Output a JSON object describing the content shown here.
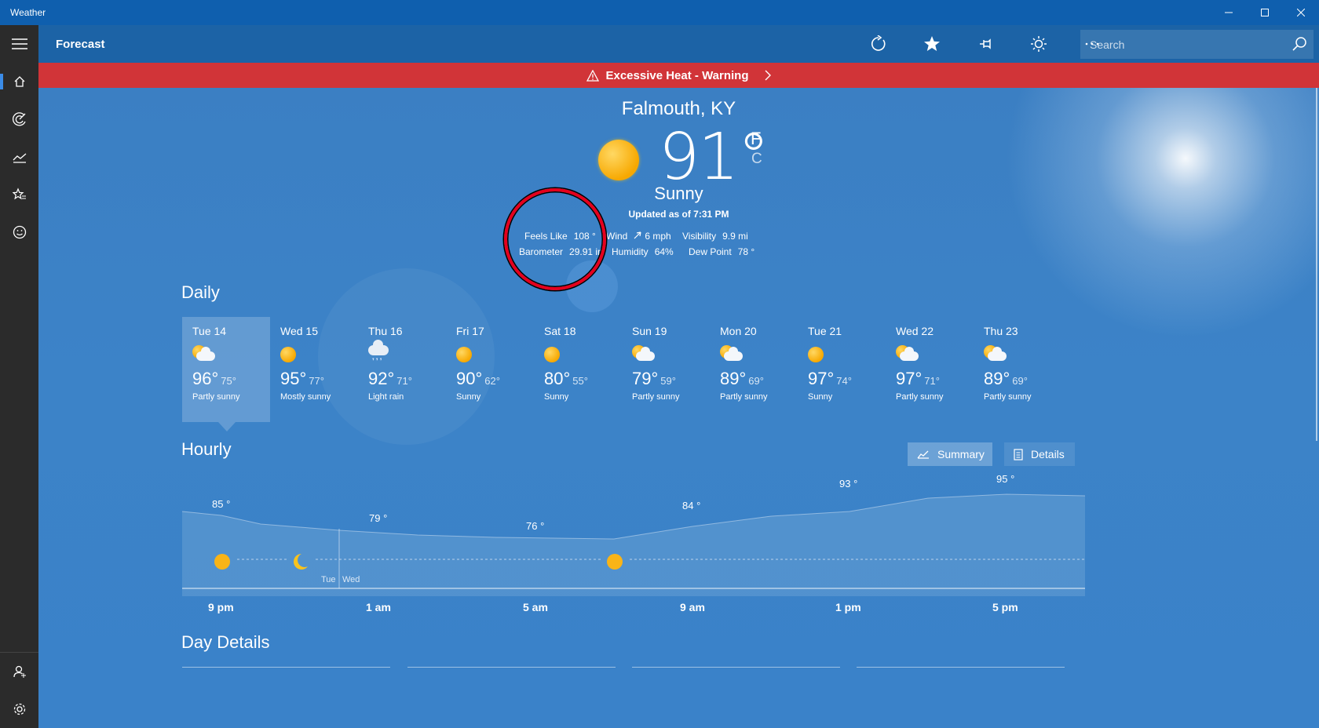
{
  "window": {
    "title": "Weather"
  },
  "header": {
    "page_title": "Forecast",
    "search_placeholder": "Search"
  },
  "alert": {
    "text": "Excessive Heat - Warning"
  },
  "current": {
    "city": "Falmouth, KY",
    "temp": "91°",
    "unit_f": "F",
    "unit_c": "C",
    "condition": "Sunny",
    "updated": "Updated as of 7:31 PM",
    "feels_like_label": "Feels Like",
    "feels_like": "108 °",
    "wind_label": "Wind",
    "wind": "6 mph",
    "visibility_label": "Visibility",
    "visibility": "9.9 mi",
    "barometer_label": "Barometer",
    "barometer": "29.91 in",
    "humidity_label": "Humidity",
    "humidity": "64%",
    "dew_label": "Dew Point",
    "dew": "78 °"
  },
  "sections": {
    "daily": "Daily",
    "hourly": "Hourly",
    "day_details": "Day Details"
  },
  "daily": [
    {
      "name": "Tue 14",
      "hi": "96°",
      "lo": "75°",
      "cond": "Partly sunny",
      "icon": "partly-sunny"
    },
    {
      "name": "Wed 15",
      "hi": "95°",
      "lo": "77°",
      "cond": "Mostly sunny",
      "icon": "sunny"
    },
    {
      "name": "Thu 16",
      "hi": "92°",
      "lo": "71°",
      "cond": "Light rain",
      "icon": "rain"
    },
    {
      "name": "Fri 17",
      "hi": "90°",
      "lo": "62°",
      "cond": "Sunny",
      "icon": "sunny"
    },
    {
      "name": "Sat 18",
      "hi": "80°",
      "lo": "55°",
      "cond": "Sunny",
      "icon": "sunny"
    },
    {
      "name": "Sun 19",
      "hi": "79°",
      "lo": "59°",
      "cond": "Partly sunny",
      "icon": "partly-sunny"
    },
    {
      "name": "Mon 20",
      "hi": "89°",
      "lo": "69°",
      "cond": "Partly sunny",
      "icon": "partly-sunny"
    },
    {
      "name": "Tue 21",
      "hi": "97°",
      "lo": "74°",
      "cond": "Sunny",
      "icon": "sunny"
    },
    {
      "name": "Wed 22",
      "hi": "97°",
      "lo": "71°",
      "cond": "Partly sunny",
      "icon": "partly-sunny"
    },
    {
      "name": "Thu 23",
      "hi": "89°",
      "lo": "69°",
      "cond": "Partly sunny",
      "icon": "partly-sunny"
    }
  ],
  "hourly_view": {
    "summary_label": "Summary",
    "details_label": "Details"
  },
  "hourly_chart": {
    "temp_labels": [
      "85 °",
      "79 °",
      "76 °",
      "84 °",
      "93 °",
      "95 °"
    ],
    "day_markers": [
      "Tue",
      "Wed"
    ],
    "time_labels": [
      "9 pm",
      "1 am",
      "5 am",
      "9 am",
      "1 pm",
      "5 pm"
    ]
  }
}
